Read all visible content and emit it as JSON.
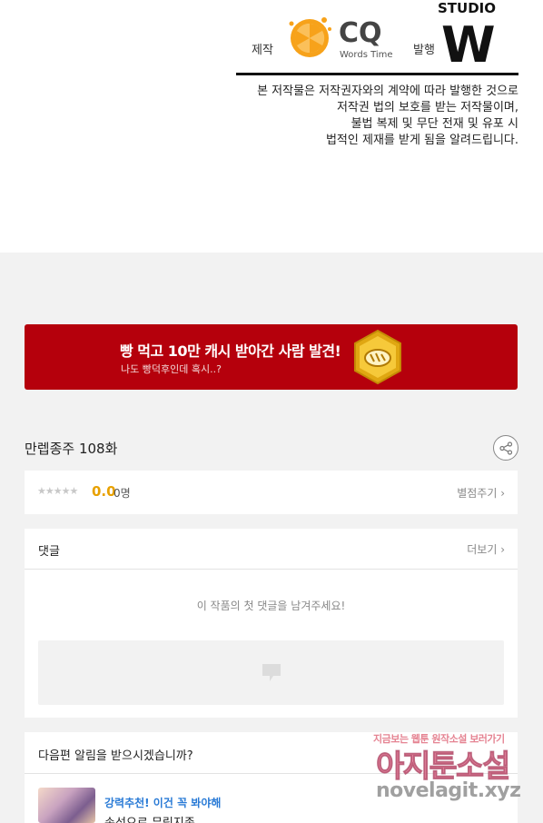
{
  "credits": {
    "production_label": "제작",
    "publisher_label": "발행",
    "cq_logo_text": "CQ",
    "cq_logo_subtext": "Words Time",
    "studio_logo_text": "STUDIO",
    "studio_logo_letter": "W",
    "copyright_lines": [
      "본 저작물은 저작권자와의 계약에 따라 발행한 것으로",
      "저작권 법의 보호를 받는 저작물이며,",
      "불법 복제 및 무단 전재 및 유포 시",
      "법적인 제재를 받게 됨을 알려드립니다."
    ]
  },
  "banner": {
    "title": "빵 먹고 10만 캐시 받아간 사람 발견!",
    "subtitle": "나도 빵덕후인데 혹시..?",
    "coin_icon": "bread-coin-icon"
  },
  "episode": {
    "title": "만렙종주 108화",
    "share_icon": "share-icon"
  },
  "rating": {
    "stars": "★★★★★",
    "score": "0.0",
    "count": "0명",
    "rate_link": "별점주기 ›"
  },
  "comments": {
    "title": "댓글",
    "more_link": "더보기 ›",
    "empty_message": "이 작품의 첫 댓글을 남겨주세요!"
  },
  "notify": {
    "title": "다음편 알림을 받으시겠습니까?",
    "recommend_badge": "강력추천! 이건 꼭 봐야해",
    "recommend_title": "손성으로 무림지존"
  },
  "watermark": {
    "top": "지금보는 웹툰 원작소설 보러가기",
    "main": "아지툰소설",
    "url": "novelagit.xyz"
  },
  "colors": {
    "banner_red": "#b5000c",
    "score_orange": "#e8a100",
    "link_blue": "#2a7bd6",
    "background_gray": "#f2f2f2"
  }
}
